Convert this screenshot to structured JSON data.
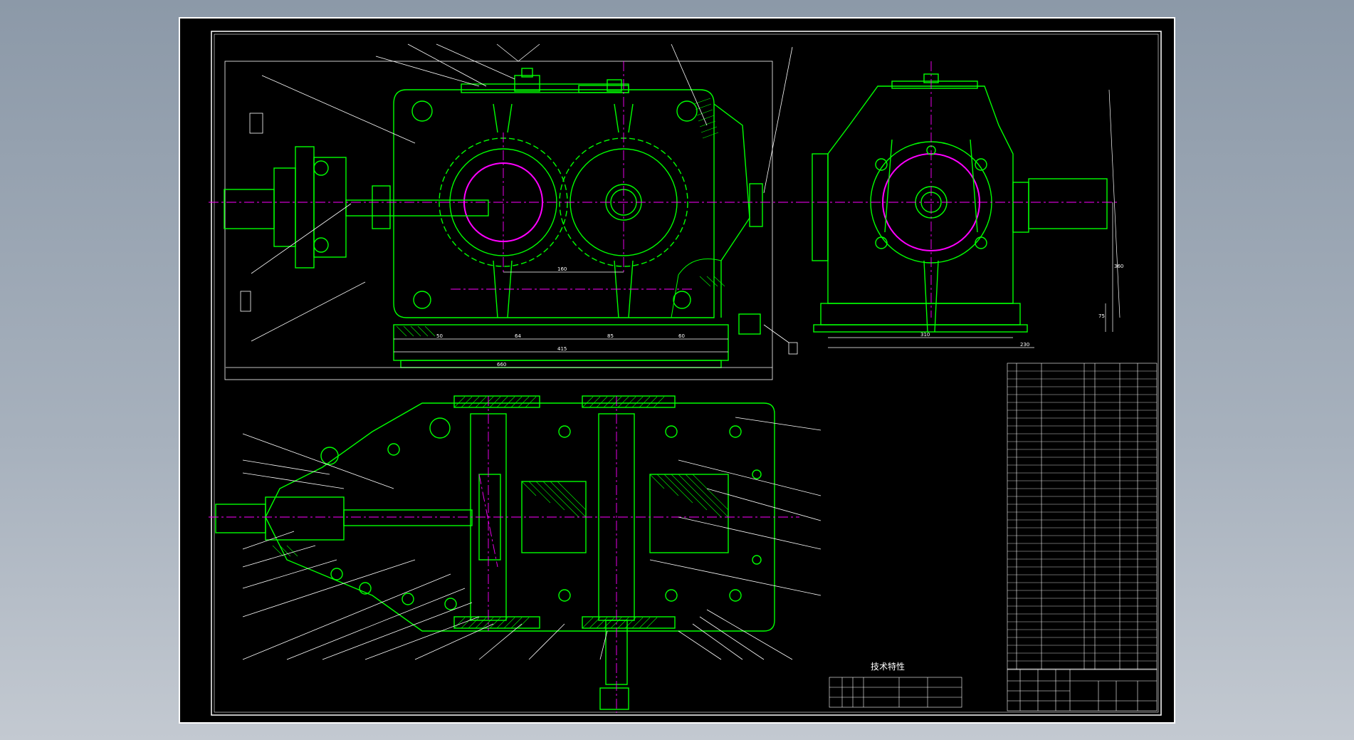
{
  "drawing": {
    "technical_spec_title": "技术特性",
    "colors": {
      "background": "#000000",
      "outline": "#00ff00",
      "centerline": "#ff00ff",
      "dimension": "#ffffff",
      "viewer_background": "#9aa5b2"
    },
    "dimensions": {
      "top_overall": "660",
      "top_sub": "415",
      "top_bases": [
        "50",
        "64",
        "85",
        "60"
      ],
      "center_distance": "160",
      "side_width": "310",
      "side_offset": "230",
      "side_height": "360",
      "side_small": "75"
    }
  }
}
